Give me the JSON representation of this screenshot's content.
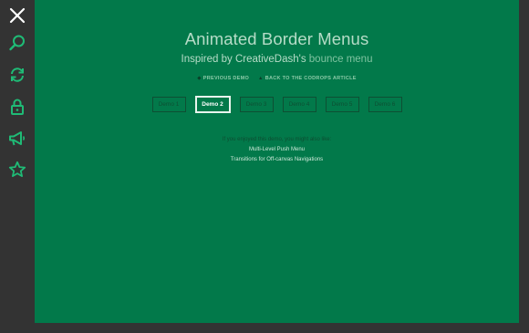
{
  "sidebar": {
    "icons": [
      "close-icon",
      "search-icon",
      "refresh-icon",
      "lock-icon",
      "megaphone-icon",
      "star-icon"
    ],
    "accent_color": "#1fbb76"
  },
  "header": {
    "title": "Animated Border Menus",
    "subtitle_prefix": "Inspired by CreativeDash's ",
    "subtitle_link": "bounce menu",
    "prev_demo": "PREVIOUS DEMO",
    "back_article": "BACK TO THE CODROPS ARTICLE"
  },
  "demos": [
    {
      "label": "Demo 1",
      "active": false
    },
    {
      "label": "Demo 2",
      "active": true
    },
    {
      "label": "Demo 3",
      "active": false
    },
    {
      "label": "Demo 4",
      "active": false
    },
    {
      "label": "Demo 5",
      "active": false
    },
    {
      "label": "Demo 6",
      "active": false
    }
  ],
  "related": {
    "intro": "If you enjoyed this demo, you might also like:",
    "links": [
      "Multi-Level Push Menu",
      "Transitions for Off-canvas Navigations"
    ]
  },
  "colors": {
    "background": "#333333",
    "content_bg": "#02794a"
  }
}
